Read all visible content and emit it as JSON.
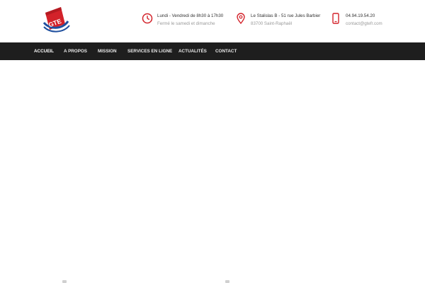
{
  "header": {
    "logo_icon": "gte-logo",
    "hours": {
      "icon": "clock-icon",
      "line1": "Lundi - Vendredi de 8h30 à 17h30",
      "line2": "Fermé le samedi et dimanche"
    },
    "address": {
      "icon": "map-pin-icon",
      "line1": "Le Stalislas B - 51 rue Jules Barbier",
      "line2": "83700 Saint-Raphaël"
    },
    "contact": {
      "icon": "mobile-phone-icon",
      "line1": "04.94.19.54.20",
      "line2": "contact@gtefr.com"
    }
  },
  "nav": {
    "items": [
      {
        "label": "ACCUEIL"
      },
      {
        "label": "A PROPOS"
      },
      {
        "label": "MISSION"
      },
      {
        "label": "SERVICES EN LIGNE"
      },
      {
        "label": "ACTUALITÉS"
      },
      {
        "label": "CONTACT"
      }
    ]
  },
  "colors": {
    "accent": "#d3222a",
    "nav_bg": "#1e1e1e",
    "logo_blue": "#1f4f9e"
  }
}
